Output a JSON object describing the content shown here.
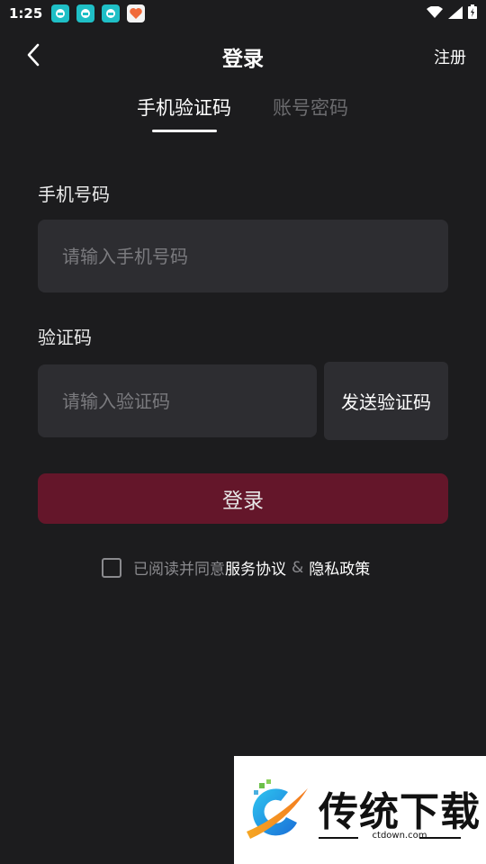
{
  "status_bar": {
    "time": "1:25",
    "icons": [
      "app-teal-icon",
      "app-teal-icon",
      "app-teal-icon",
      "app-heart-icon",
      "wifi-icon",
      "signal-icon",
      "battery-charging-icon"
    ]
  },
  "header": {
    "title": "登录",
    "register_label": "注册",
    "back_icon": "chevron-left-icon"
  },
  "tabs": [
    {
      "label": "手机验证码",
      "active": true
    },
    {
      "label": "账号密码",
      "active": false
    }
  ],
  "form": {
    "phone": {
      "label": "手机号码",
      "placeholder": "请输入手机号码",
      "value": ""
    },
    "code": {
      "label": "验证码",
      "placeholder": "请输入验证码",
      "value": "",
      "send_label": "发送验证码"
    },
    "submit_label": "登录"
  },
  "agreement": {
    "checked": false,
    "prefix": "已阅读并同意",
    "terms_label": "服务协议",
    "separator": "&",
    "privacy_label": "隐私政策"
  },
  "watermark": {
    "title": "传统下载",
    "url": "ctdown.com"
  },
  "colors": {
    "background": "#1c1c1e",
    "input_bg": "#2d2d31",
    "primary_button": "#64162a",
    "muted_text": "#8a8a8e"
  }
}
